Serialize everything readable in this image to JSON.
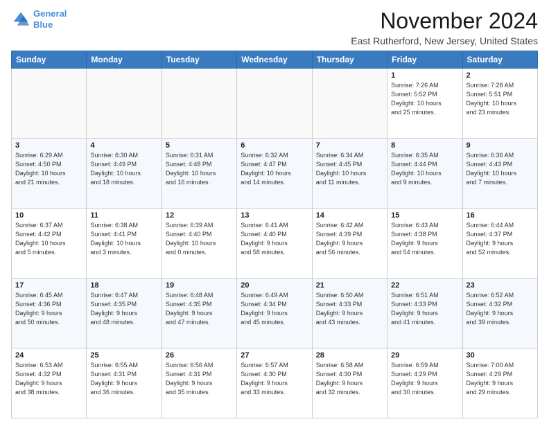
{
  "header": {
    "logo_line1": "General",
    "logo_line2": "Blue",
    "title": "November 2024",
    "subtitle": "East Rutherford, New Jersey, United States"
  },
  "calendar": {
    "headers": [
      "Sunday",
      "Monday",
      "Tuesday",
      "Wednesday",
      "Thursday",
      "Friday",
      "Saturday"
    ],
    "rows": [
      [
        {
          "day": "",
          "info": ""
        },
        {
          "day": "",
          "info": ""
        },
        {
          "day": "",
          "info": ""
        },
        {
          "day": "",
          "info": ""
        },
        {
          "day": "",
          "info": ""
        },
        {
          "day": "1",
          "info": "Sunrise: 7:26 AM\nSunset: 5:52 PM\nDaylight: 10 hours\nand 25 minutes."
        },
        {
          "day": "2",
          "info": "Sunrise: 7:28 AM\nSunset: 5:51 PM\nDaylight: 10 hours\nand 23 minutes."
        }
      ],
      [
        {
          "day": "3",
          "info": "Sunrise: 6:29 AM\nSunset: 4:50 PM\nDaylight: 10 hours\nand 21 minutes."
        },
        {
          "day": "4",
          "info": "Sunrise: 6:30 AM\nSunset: 4:49 PM\nDaylight: 10 hours\nand 18 minutes."
        },
        {
          "day": "5",
          "info": "Sunrise: 6:31 AM\nSunset: 4:48 PM\nDaylight: 10 hours\nand 16 minutes."
        },
        {
          "day": "6",
          "info": "Sunrise: 6:32 AM\nSunset: 4:47 PM\nDaylight: 10 hours\nand 14 minutes."
        },
        {
          "day": "7",
          "info": "Sunrise: 6:34 AM\nSunset: 4:45 PM\nDaylight: 10 hours\nand 11 minutes."
        },
        {
          "day": "8",
          "info": "Sunrise: 6:35 AM\nSunset: 4:44 PM\nDaylight: 10 hours\nand 9 minutes."
        },
        {
          "day": "9",
          "info": "Sunrise: 6:36 AM\nSunset: 4:43 PM\nDaylight: 10 hours\nand 7 minutes."
        }
      ],
      [
        {
          "day": "10",
          "info": "Sunrise: 6:37 AM\nSunset: 4:42 PM\nDaylight: 10 hours\nand 5 minutes."
        },
        {
          "day": "11",
          "info": "Sunrise: 6:38 AM\nSunset: 4:41 PM\nDaylight: 10 hours\nand 3 minutes."
        },
        {
          "day": "12",
          "info": "Sunrise: 6:39 AM\nSunset: 4:40 PM\nDaylight: 10 hours\nand 0 minutes."
        },
        {
          "day": "13",
          "info": "Sunrise: 6:41 AM\nSunset: 4:40 PM\nDaylight: 9 hours\nand 58 minutes."
        },
        {
          "day": "14",
          "info": "Sunrise: 6:42 AM\nSunset: 4:39 PM\nDaylight: 9 hours\nand 56 minutes."
        },
        {
          "day": "15",
          "info": "Sunrise: 6:43 AM\nSunset: 4:38 PM\nDaylight: 9 hours\nand 54 minutes."
        },
        {
          "day": "16",
          "info": "Sunrise: 6:44 AM\nSunset: 4:37 PM\nDaylight: 9 hours\nand 52 minutes."
        }
      ],
      [
        {
          "day": "17",
          "info": "Sunrise: 6:45 AM\nSunset: 4:36 PM\nDaylight: 9 hours\nand 50 minutes."
        },
        {
          "day": "18",
          "info": "Sunrise: 6:47 AM\nSunset: 4:35 PM\nDaylight: 9 hours\nand 48 minutes."
        },
        {
          "day": "19",
          "info": "Sunrise: 6:48 AM\nSunset: 4:35 PM\nDaylight: 9 hours\nand 47 minutes."
        },
        {
          "day": "20",
          "info": "Sunrise: 6:49 AM\nSunset: 4:34 PM\nDaylight: 9 hours\nand 45 minutes."
        },
        {
          "day": "21",
          "info": "Sunrise: 6:50 AM\nSunset: 4:33 PM\nDaylight: 9 hours\nand 43 minutes."
        },
        {
          "day": "22",
          "info": "Sunrise: 6:51 AM\nSunset: 4:33 PM\nDaylight: 9 hours\nand 41 minutes."
        },
        {
          "day": "23",
          "info": "Sunrise: 6:52 AM\nSunset: 4:32 PM\nDaylight: 9 hours\nand 39 minutes."
        }
      ],
      [
        {
          "day": "24",
          "info": "Sunrise: 6:53 AM\nSunset: 4:32 PM\nDaylight: 9 hours\nand 38 minutes."
        },
        {
          "day": "25",
          "info": "Sunrise: 6:55 AM\nSunset: 4:31 PM\nDaylight: 9 hours\nand 36 minutes."
        },
        {
          "day": "26",
          "info": "Sunrise: 6:56 AM\nSunset: 4:31 PM\nDaylight: 9 hours\nand 35 minutes."
        },
        {
          "day": "27",
          "info": "Sunrise: 6:57 AM\nSunset: 4:30 PM\nDaylight: 9 hours\nand 33 minutes."
        },
        {
          "day": "28",
          "info": "Sunrise: 6:58 AM\nSunset: 4:30 PM\nDaylight: 9 hours\nand 32 minutes."
        },
        {
          "day": "29",
          "info": "Sunrise: 6:59 AM\nSunset: 4:29 PM\nDaylight: 9 hours\nand 30 minutes."
        },
        {
          "day": "30",
          "info": "Sunrise: 7:00 AM\nSunset: 4:29 PM\nDaylight: 9 hours\nand 29 minutes."
        }
      ]
    ]
  }
}
